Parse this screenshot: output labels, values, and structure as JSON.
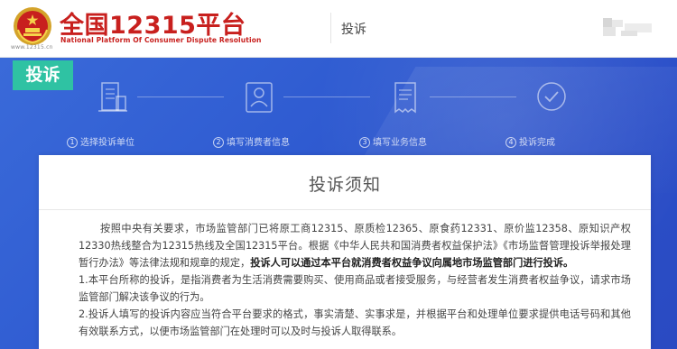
{
  "header": {
    "logo_title": "全国12315平台",
    "logo_subtitle": "National Platform Of Consumer Dispute Resolution",
    "emblem_site": "www.12315.cn",
    "nav_label": "投诉"
  },
  "banner": {
    "tag": "投诉",
    "steps": [
      {
        "num": "1",
        "label": "选择投诉单位",
        "icon": "building-document-icon"
      },
      {
        "num": "2",
        "label": "填写消费者信息",
        "icon": "user-profile-icon"
      },
      {
        "num": "3",
        "label": "填写业务信息",
        "icon": "receipt-icon"
      },
      {
        "num": "4",
        "label": "投诉完成",
        "icon": "check-circle-icon"
      }
    ]
  },
  "notice": {
    "title": "投诉须知",
    "p1_normal": "按照中央有关要求，市场监管部门已将原工商12315、原质检12365、原食药12331、原价监12358、原知识产权12330热线整合为12315热线及全国12315平台。根据《中华人民共和国消费者权益保护法》《市场监督管理投诉举报处理暂行办法》等法律法规和规章的规定，",
    "p1_bold": "投诉人可以通过本平台就消费者权益争议向属地市场监管部门进行投诉。",
    "p2": "1.本平台所称的投诉，是指消费者为生活消费需要购买、使用商品或者接受服务，与经营者发生消费者权益争议，请求市场监管部门解决该争议的行为。",
    "p3": "2.投诉人填写的投诉内容应当符合平台要求的格式，事实清楚、实事求是，并根据平台和处理单位要求提供电话号码和其他有效联系方式，以便市场监管部门在处理时可以及时与投诉人取得联系。"
  },
  "colors": {
    "brand_red": "#c8201e",
    "banner_blue": "#2f5bd1",
    "tag_green": "#2fc2a3"
  }
}
